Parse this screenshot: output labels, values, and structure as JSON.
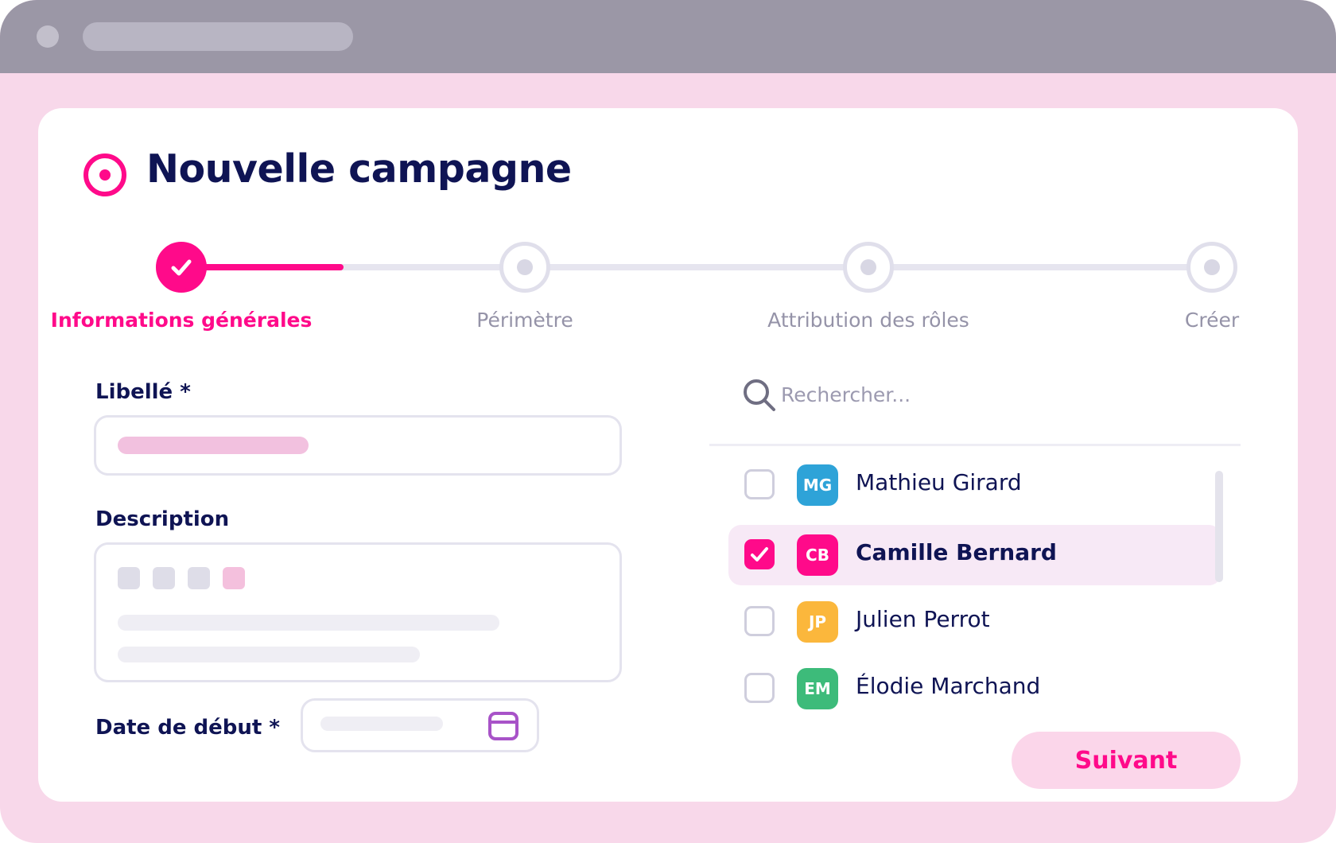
{
  "window": {
    "chrome_color": "#9b97a6",
    "background_color": "#f8d8ea"
  },
  "page": {
    "title": "Nouvelle campagne",
    "title_icon": "target-icon",
    "accent_color": "#ff0a8a",
    "title_color": "#0f1454"
  },
  "stepper": {
    "steps": [
      {
        "label": "Informations générales",
        "state": "completed"
      },
      {
        "label": "Périmètre",
        "state": "pending"
      },
      {
        "label": "Attribution des rôles",
        "state": "pending"
      },
      {
        "label": "Créer",
        "state": "pending"
      }
    ]
  },
  "form": {
    "libelle_label": "Libellé *",
    "description_label": "Description",
    "start_date_label": "Date de début *"
  },
  "people": {
    "search_placeholder": "Rechercher...",
    "items": [
      {
        "initials": "MG",
        "name": "Mathieu Girard",
        "color": "#2ea3d8",
        "checked": false
      },
      {
        "initials": "CB",
        "name": "Camille Bernard",
        "color": "#ff0a8a",
        "checked": true
      },
      {
        "initials": "JP",
        "name": "Julien Perrot",
        "color": "#fbb73c",
        "checked": false
      },
      {
        "initials": "EM",
        "name": "Élodie Marchand",
        "color": "#3dbb7a",
        "checked": false
      }
    ]
  },
  "actions": {
    "next_label": "Suivant"
  }
}
